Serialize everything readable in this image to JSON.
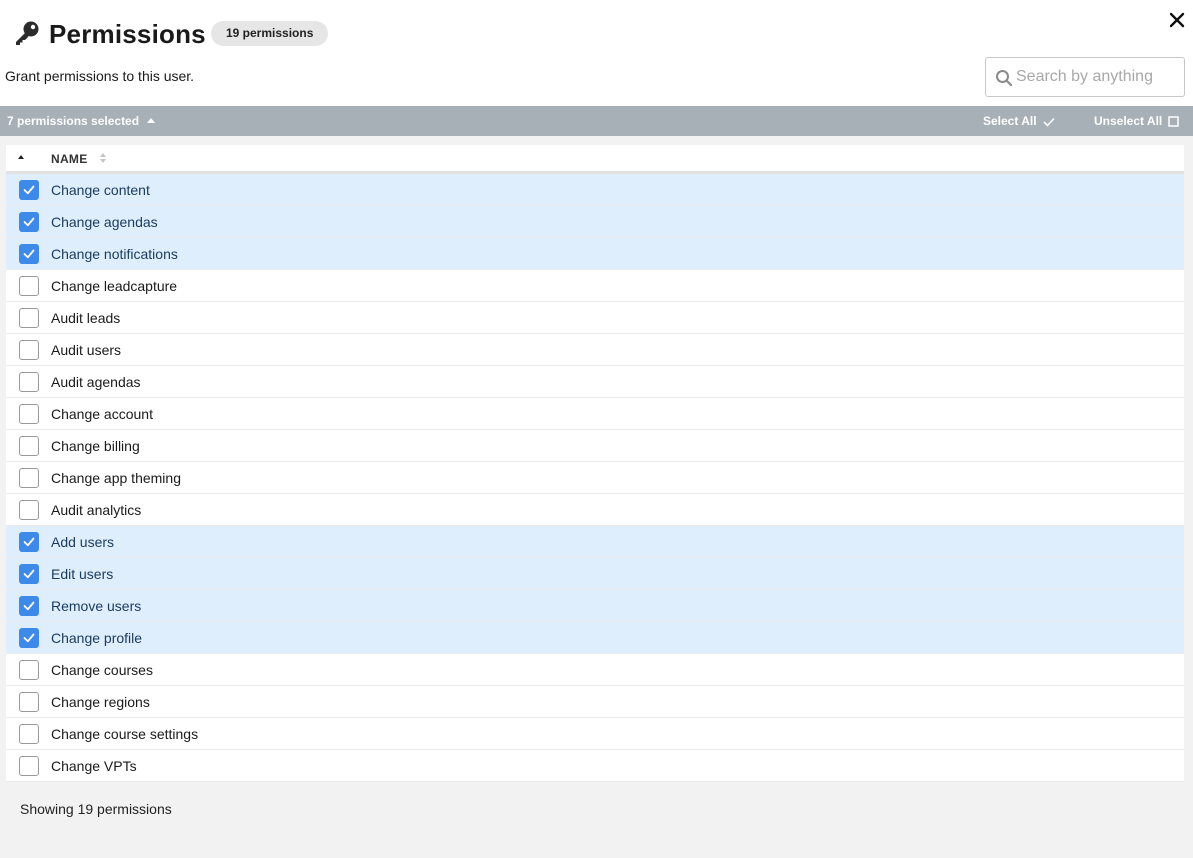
{
  "header": {
    "title": "Permissions",
    "count_badge": "19 permissions",
    "subtitle": "Grant permissions to this user.",
    "icon": "key-icon",
    "close_icon": "close-icon"
  },
  "search": {
    "placeholder": "Search by anything",
    "value": "",
    "icon": "search-icon"
  },
  "selection_bar": {
    "selected_label": "7 permissions selected",
    "select_all_label": "Select All",
    "unselect_all_label": "Unselect All"
  },
  "table": {
    "columns": [
      "NAME"
    ],
    "rows": [
      {
        "label": "Change content",
        "checked": true
      },
      {
        "label": "Change agendas",
        "checked": true
      },
      {
        "label": "Change notifications",
        "checked": true
      },
      {
        "label": "Change leadcapture",
        "checked": false
      },
      {
        "label": "Audit leads",
        "checked": false
      },
      {
        "label": "Audit users",
        "checked": false
      },
      {
        "label": "Audit agendas",
        "checked": false
      },
      {
        "label": "Change account",
        "checked": false
      },
      {
        "label": "Change billing",
        "checked": false
      },
      {
        "label": "Change app theming",
        "checked": false
      },
      {
        "label": "Audit analytics",
        "checked": false
      },
      {
        "label": "Add users",
        "checked": true
      },
      {
        "label": "Edit users",
        "checked": true
      },
      {
        "label": "Remove users",
        "checked": true
      },
      {
        "label": "Change profile",
        "checked": true
      },
      {
        "label": "Change courses",
        "checked": false
      },
      {
        "label": "Change regions",
        "checked": false
      },
      {
        "label": "Change course settings",
        "checked": false
      },
      {
        "label": "Change VPTs",
        "checked": false
      }
    ]
  },
  "footer": {
    "showing_label": "Showing 19 permissions"
  },
  "colors": {
    "selection_bar": "#a7afb7",
    "checked_row": "#dfeefd",
    "checkbox_checked": "#3d8ae8",
    "content_bg": "#f2f2f2"
  }
}
